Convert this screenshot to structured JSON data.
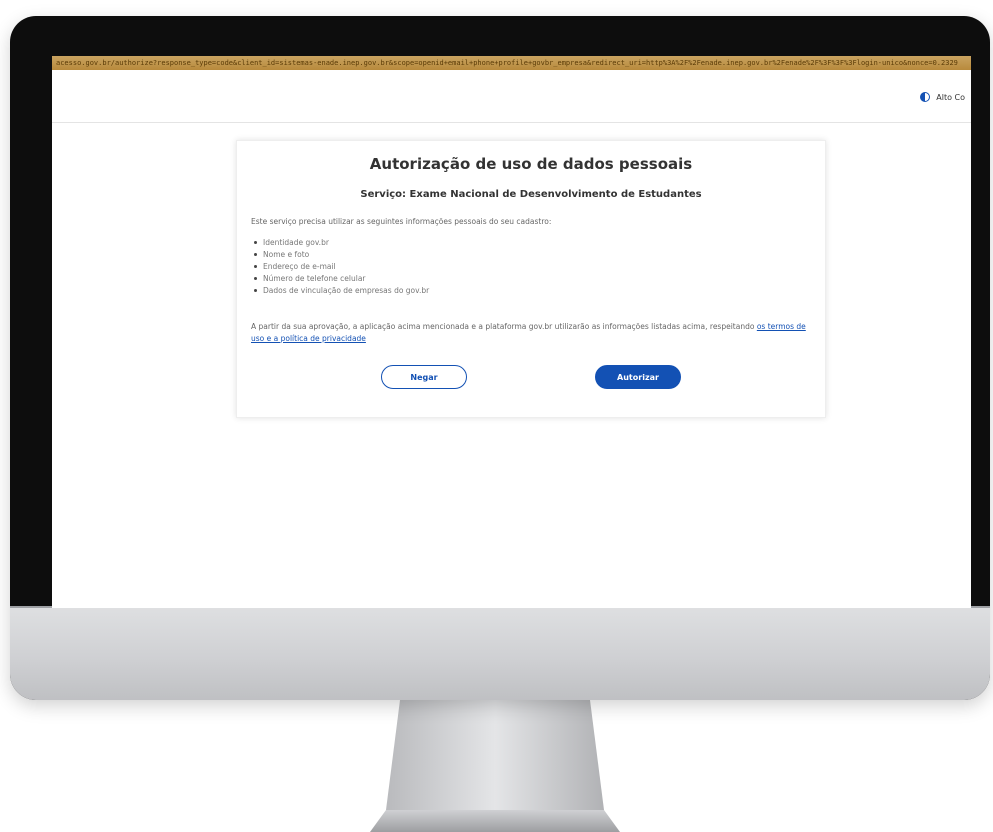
{
  "browser": {
    "url": "acesso.gov.br/authorize?response_type=code&client_id=sistemas-enade.inep.gov.br&scope=openid+email+phone+profile+govbr_empresa&redirect_uri=http%3A%2F%2Fenade.inep.gov.br%2Fenade%2F%3F%3F%3Flogin-unico&nonce=0.2329"
  },
  "header": {
    "contrast_label": "Alto Co"
  },
  "consent": {
    "title": "Autorização de uso de dados pessoais",
    "service": "Serviço: Exame Nacional de Desenvolvimento de Estudantes",
    "intro": "Este serviço precisa utilizar as seguintes informações pessoais do seu cadastro:",
    "items": [
      "Identidade gov.br",
      "Nome e foto",
      "Endereço de e-mail",
      "Número de telefone celular",
      "Dados de vinculação de empresas do gov.br"
    ],
    "note_text": "A partir da sua aprovação, a aplicação acima mencionada e a plataforma gov.br utilizarão as informações listadas acima, respeitando",
    "note_link": "os termos de uso e a política de privacidade",
    "deny_label": "Negar",
    "authorize_label": "Autorizar"
  },
  "colors": {
    "accent": "#1351b4",
    "url_bar": "#c9a360",
    "bezel": "#0d0d0d",
    "chin": "#cfd0d3"
  }
}
